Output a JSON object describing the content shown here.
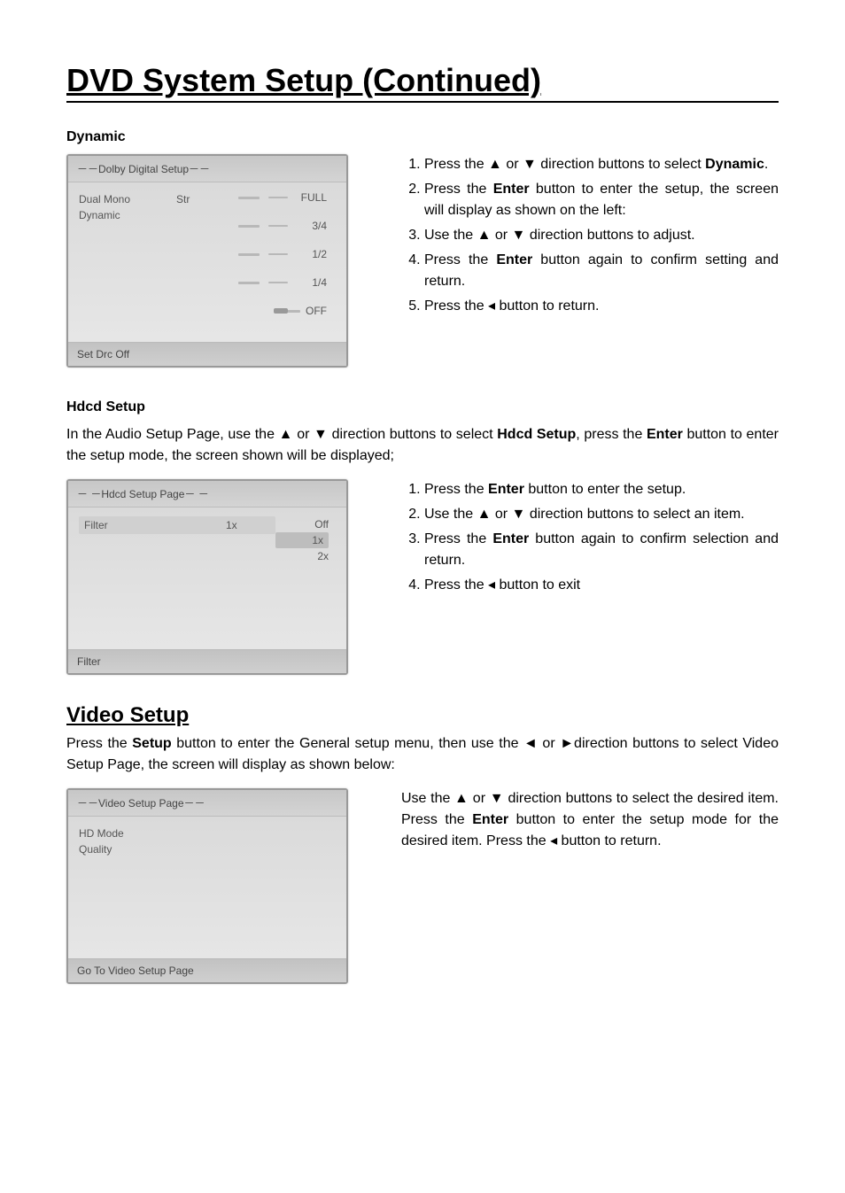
{
  "title": "DVD System Setup (Continued)",
  "dynamic": {
    "label": "Dynamic",
    "shot_title": "－－Dolby Digital Setup－－",
    "rows": [
      {
        "label": "Dual Mono",
        "val": "Str"
      },
      {
        "label": "Dynamic",
        "val": ""
      }
    ],
    "ticks": [
      "FULL",
      "3/4",
      "1/2",
      "1/4",
      "OFF"
    ],
    "shot_footer": "Set Drc Off",
    "steps": {
      "s1a": "Press the ▲ or ▼ direction buttons to select ",
      "s1b": "Dynamic",
      "s1c": ".",
      "s2a": "Press the ",
      "s2b": "Enter",
      "s2c": " button to enter the setup, the screen will display as shown on the left:",
      "s3": "Use the ▲ or ▼ direction buttons to adjust.",
      "s4a": "Press the ",
      "s4b": "Enter",
      "s4c": " button again to confirm setting and return.",
      "s5": "Press the ◂ button to return."
    }
  },
  "hdcd": {
    "label": "Hdcd Setup",
    "intro_a": "In the Audio Setup Page, use the ▲ or ▼ direction buttons to select ",
    "intro_b": "Hdcd Setup",
    "intro_c": ", press the ",
    "intro_d": "Enter",
    "intro_e": " button to enter the setup mode, the screen shown will be displayed;",
    "shot_title": "－ －Hdcd  Setup Page－ －",
    "row_label": "Filter",
    "row_val": "1x",
    "opts": [
      "Off",
      "1x",
      "2x"
    ],
    "shot_footer": "Filter",
    "steps": {
      "s1a": "Press the ",
      "s1b": "Enter",
      "s1c": " button to enter the setup.",
      "s2": "Use the ▲ or ▼ direction buttons to select an item.",
      "s3a": "Press the ",
      "s3b": "Enter",
      "s3c": " button again to confirm selection and return.",
      "s4": "Press the ◂ button to exit"
    }
  },
  "video": {
    "heading": "Video Setup",
    "intro_a": "Press the ",
    "intro_b": "Setup",
    "intro_c": " button to enter the General setup menu, then use the ◄ or ►direction buttons to select Video Setup Page, the screen will display as shown below:",
    "shot_title": "－－Video Setup Page－－",
    "items": [
      "HD Mode",
      "Quality"
    ],
    "shot_footer": "Go To Video Setup Page",
    "para_a": "Use the ▲ or ▼ direction buttons to select the desired item. Press the ",
    "para_b": "Enter",
    "para_c": " button to enter the setup mode for the desired item. Press the ◂ button to return."
  }
}
